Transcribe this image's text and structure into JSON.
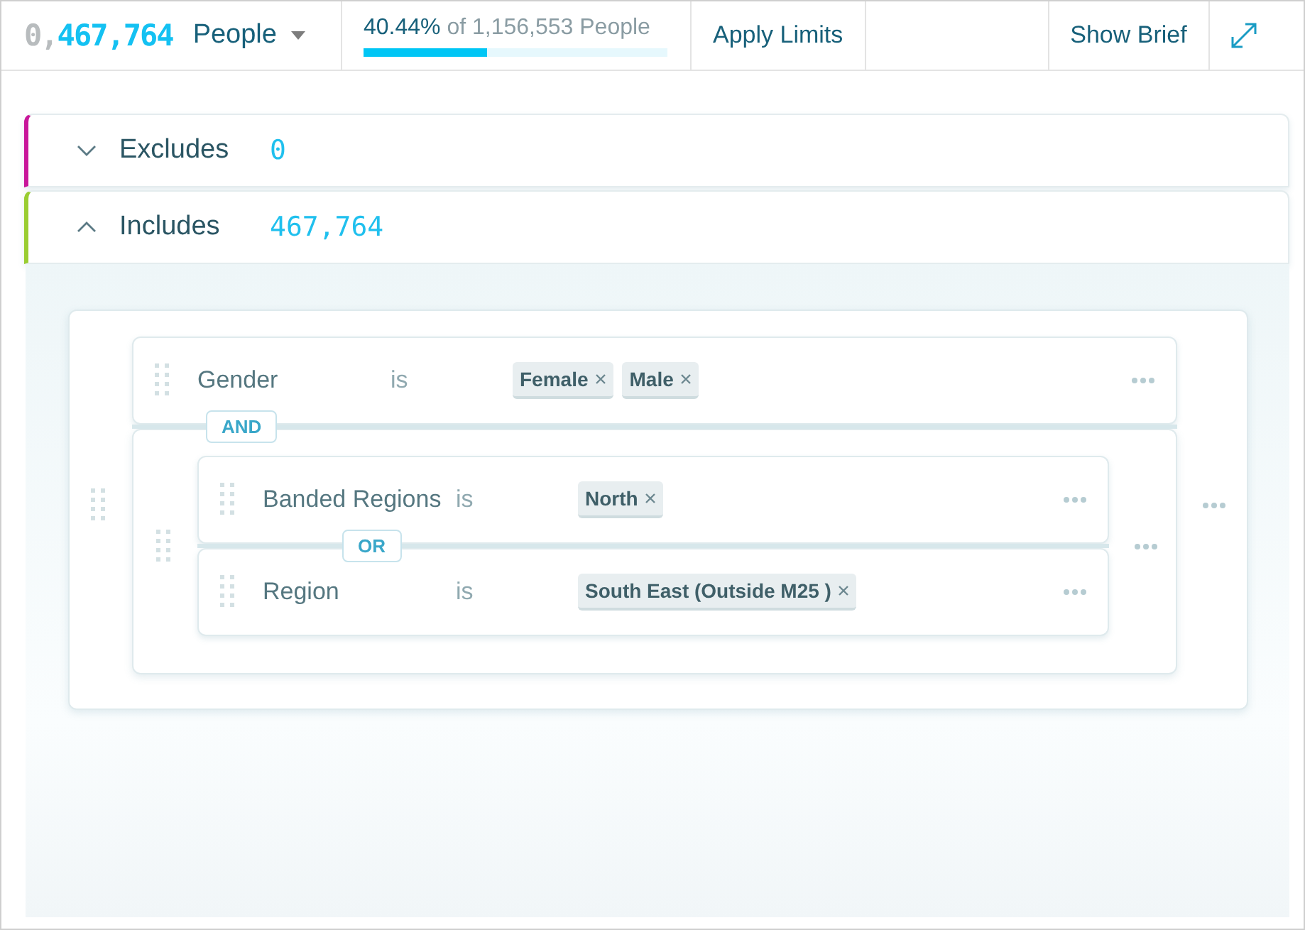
{
  "header": {
    "count_faded": "0,",
    "count": "467,764",
    "unit": "People",
    "coverage": "40.44%",
    "coverage_rest": "of 1,156,553 People",
    "level": 0.4044,
    "apply": "Apply Limits",
    "brief": "Show Brief"
  },
  "sections": [
    {
      "label": "Excludes",
      "count": "0",
      "expanded": false,
      "color": "#c8179a"
    },
    {
      "label": "Includes",
      "count": "467,764",
      "expanded": true,
      "color": "#9acd32",
      "query": {
        "kind": "group",
        "operator": "AND",
        "children": [
          {
            "kind": "rule",
            "field": "Gender",
            "op": "is",
            "values": [
              "Female",
              "Male"
            ]
          },
          {
            "kind": "group",
            "operator": "OR",
            "children": [
              {
                "kind": "rule",
                "field": "Banded Regions",
                "op": "is",
                "values": [
                  "North"
                ]
              },
              {
                "kind": "rule",
                "field": "Region",
                "op": "is",
                "values": [
                  "South East (Outside M25 )"
                ]
              }
            ]
          }
        ]
      }
    }
  ]
}
